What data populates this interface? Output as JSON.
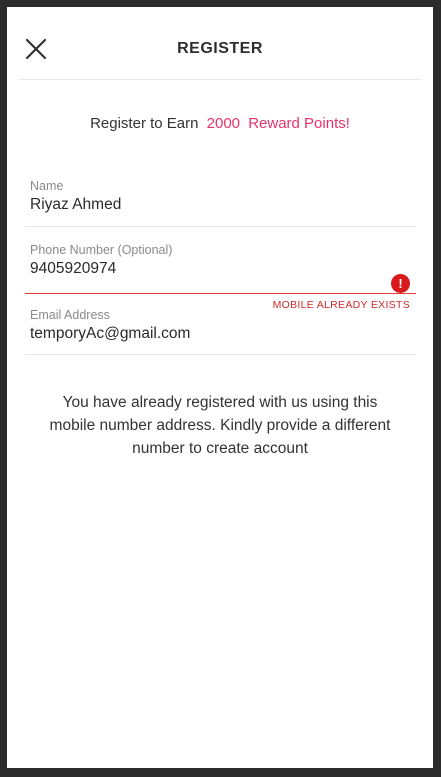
{
  "header": {
    "title": "REGISTER",
    "close_icon": "close-icon"
  },
  "promo": {
    "prefix": "Register to Earn",
    "points": "2000",
    "suffix": "Reward Points!",
    "accent_color": "#e8336d"
  },
  "form": {
    "name": {
      "label": "Name",
      "value": "Riyaz Ahmed"
    },
    "phone": {
      "label": "Phone Number (Optional)",
      "value": "9405920974",
      "error": "MOBILE ALREADY EXISTS",
      "error_icon": "alert-icon",
      "error_color": "#d81a1a"
    },
    "email": {
      "label": "Email Address",
      "value": "temporyAc@gmail.com"
    }
  },
  "message": "You have already registered with us using this mobile number address. Kindly provide a different number to create account"
}
